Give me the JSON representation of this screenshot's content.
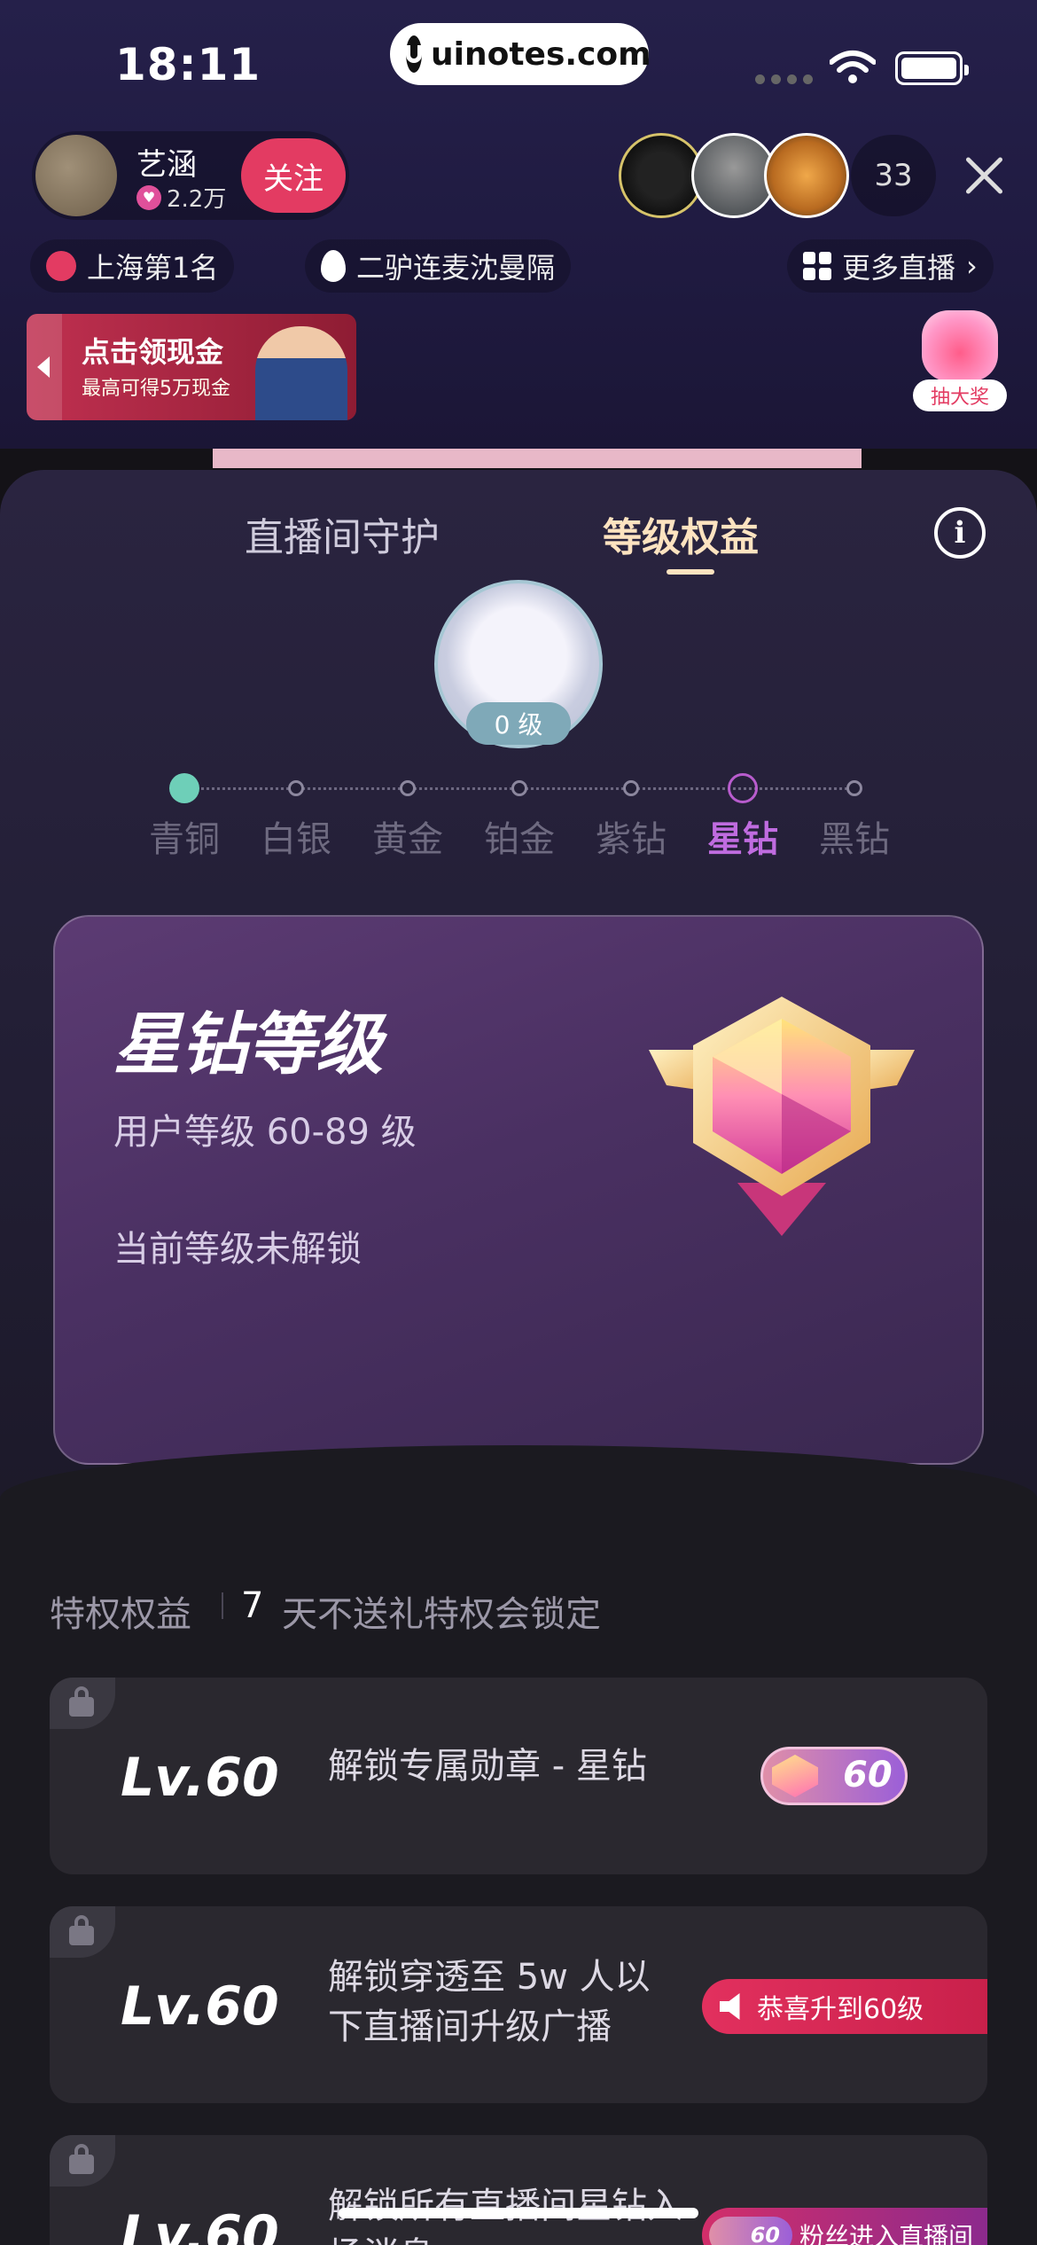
{
  "status_bar": {
    "time": "18:11",
    "watermark": "uinotes.com"
  },
  "host": {
    "name": "艺涵",
    "fans": "2.2万",
    "follow_label": "关注"
  },
  "viewers": {
    "count": "33"
  },
  "chips": {
    "rank": "上海第1名",
    "pk": "二驴连麦沈曼隔",
    "more": "更多直播"
  },
  "banner": {
    "title": "点击领现金",
    "subtitle": "最高可得5万现金"
  },
  "lottery": {
    "label": "抽大奖"
  },
  "tabs": {
    "guard": "直播间守护",
    "level": "等级权益"
  },
  "info_icon": "i",
  "user": {
    "level_badge": "0 级"
  },
  "tiers": [
    "青铜",
    "白银",
    "黄金",
    "铂金",
    "紫钻",
    "星钻",
    "黑钻"
  ],
  "current_tier_index": 5,
  "reached_tier_index": 0,
  "card": {
    "title": "星钻等级",
    "range": "用户等级 60-89 级",
    "status": "当前等级未解锁"
  },
  "privileges": {
    "label": "特权权益",
    "days": "7",
    "note": "天不送礼特权会锁定"
  },
  "rows": [
    {
      "level": "Lv.60",
      "text": "解锁专属勋章 - 星钻",
      "badge": "60"
    },
    {
      "level": "Lv.60",
      "text": "解锁穿透至 5w 人以下直播间升级广播",
      "badge": "恭喜升到60级"
    },
    {
      "level": "Lv.60",
      "text": "解锁所有直播间星钻入场消息",
      "badge_num": "60",
      "badge": "粉丝进入直播间"
    }
  ],
  "colors": {
    "accent": "#e33b62",
    "current_tier": "#c06ce0",
    "reached_tier": "#6ecfb8",
    "tab_active": "#fde3c0"
  }
}
